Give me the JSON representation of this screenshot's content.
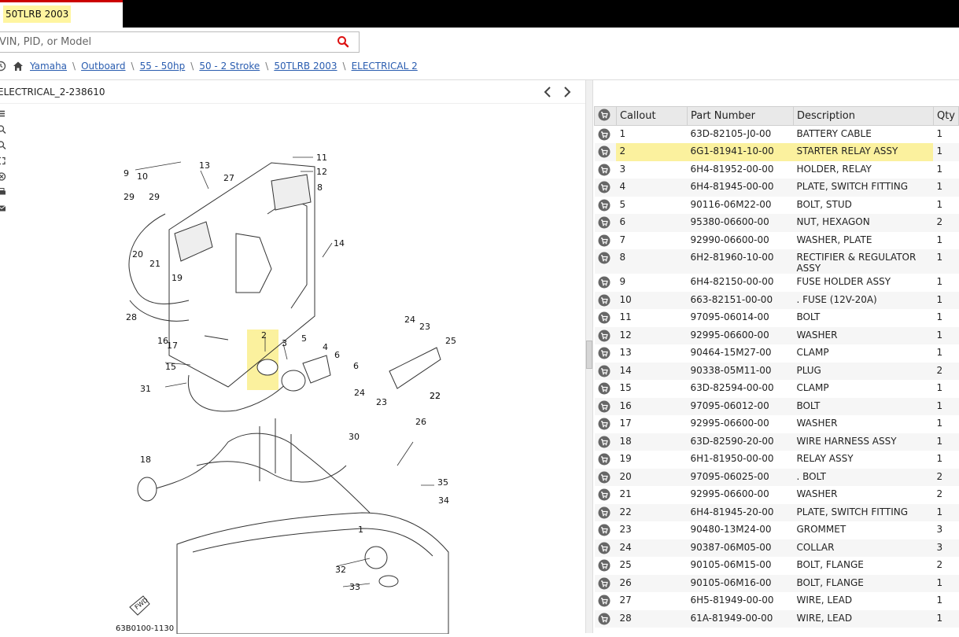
{
  "tab": {
    "label": "50TLRB 2003"
  },
  "search": {
    "placeholder": "VIN, PID, or Model"
  },
  "breadcrumb": [
    "Yamaha",
    "Outboard",
    "55 - 50hp",
    "50 - 2 Stroke",
    "50TLRB 2003",
    "ELECTRICAL 2"
  ],
  "diagram": {
    "title": "ELECTRICAL_2-238610",
    "code": "63B0100-1130",
    "fwd_label": "FWD",
    "callouts": [
      "1",
      "2",
      "3",
      "4",
      "5",
      "6",
      "6",
      "8",
      "9",
      "10",
      "11",
      "12",
      "13",
      "14",
      "15",
      "16",
      "17",
      "18",
      "19",
      "20",
      "21",
      "22",
      "22",
      "23",
      "23",
      "24",
      "24",
      "25",
      "26",
      "27",
      "28",
      "29",
      "29",
      "30",
      "31",
      "32",
      "33",
      "34",
      "35"
    ]
  },
  "table": {
    "headers": {
      "callout": "Callout",
      "part": "Part Number",
      "desc": "Description",
      "qty": "Qty"
    },
    "highlight_color": "#fbf19e",
    "rows": [
      {
        "callout": "1",
        "part": "63D-82105-J0-00",
        "desc": "BATTERY CABLE",
        "qty": "1"
      },
      {
        "callout": "2",
        "part": "6G1-81941-10-00",
        "desc": "STARTER RELAY ASSY",
        "qty": "1",
        "highlight": true
      },
      {
        "callout": "3",
        "part": "6H4-81952-00-00",
        "desc": "HOLDER, RELAY",
        "qty": "1"
      },
      {
        "callout": "4",
        "part": "6H4-81945-00-00",
        "desc": "PLATE, SWITCH FITTING",
        "qty": "1"
      },
      {
        "callout": "5",
        "part": "90116-06M22-00",
        "desc": "BOLT, STUD",
        "qty": "1"
      },
      {
        "callout": "6",
        "part": "95380-06600-00",
        "desc": "NUT, HEXAGON",
        "qty": "2"
      },
      {
        "callout": "7",
        "part": "92990-06600-00",
        "desc": "WASHER, PLATE",
        "qty": "1"
      },
      {
        "callout": "8",
        "part": "6H2-81960-10-00",
        "desc": "RECTIFIER & REGULATOR ASSY",
        "qty": "1"
      },
      {
        "callout": "9",
        "part": "6H4-82150-00-00",
        "desc": "FUSE HOLDER ASSY",
        "qty": "1"
      },
      {
        "callout": "10",
        "part": "663-82151-00-00",
        "desc": ". FUSE (12V-20A)",
        "qty": "1"
      },
      {
        "callout": "11",
        "part": "97095-06014-00",
        "desc": "BOLT",
        "qty": "1"
      },
      {
        "callout": "12",
        "part": "92995-06600-00",
        "desc": "WASHER",
        "qty": "1"
      },
      {
        "callout": "13",
        "part": "90464-15M27-00",
        "desc": "CLAMP",
        "qty": "1"
      },
      {
        "callout": "14",
        "part": "90338-05M11-00",
        "desc": "PLUG",
        "qty": "2"
      },
      {
        "callout": "15",
        "part": "63D-82594-00-00",
        "desc": "CLAMP",
        "qty": "1"
      },
      {
        "callout": "16",
        "part": "97095-06012-00",
        "desc": "BOLT",
        "qty": "1"
      },
      {
        "callout": "17",
        "part": "92995-06600-00",
        "desc": "WASHER",
        "qty": "1"
      },
      {
        "callout": "18",
        "part": "63D-82590-20-00",
        "desc": "WIRE HARNESS ASSY",
        "qty": "1"
      },
      {
        "callout": "19",
        "part": "6H1-81950-00-00",
        "desc": "RELAY ASSY",
        "qty": "1"
      },
      {
        "callout": "20",
        "part": "97095-06025-00",
        "desc": ". BOLT",
        "qty": "2"
      },
      {
        "callout": "21",
        "part": "92995-06600-00",
        "desc": "WASHER",
        "qty": "2"
      },
      {
        "callout": "22",
        "part": "6H4-81945-20-00",
        "desc": "PLATE, SWITCH FITTING",
        "qty": "1"
      },
      {
        "callout": "23",
        "part": "90480-13M24-00",
        "desc": "GROMMET",
        "qty": "3"
      },
      {
        "callout": "24",
        "part": "90387-06M05-00",
        "desc": "COLLAR",
        "qty": "3"
      },
      {
        "callout": "25",
        "part": "90105-06M15-00",
        "desc": "BOLT, FLANGE",
        "qty": "2"
      },
      {
        "callout": "26",
        "part": "90105-06M16-00",
        "desc": "BOLT, FLANGE",
        "qty": "1"
      },
      {
        "callout": "27",
        "part": "6H5-81949-00-00",
        "desc": "WIRE, LEAD",
        "qty": "1"
      },
      {
        "callout": "28",
        "part": "61A-81949-00-00",
        "desc": "WIRE, LEAD",
        "qty": "1"
      }
    ]
  }
}
